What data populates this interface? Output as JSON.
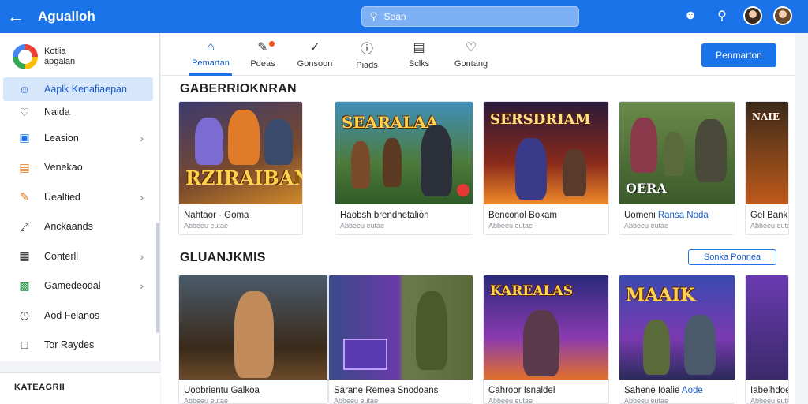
{
  "header": {
    "back_icon": "arrow-left-icon",
    "title": "Agualloh",
    "search_placeholder": "Sean",
    "icons": [
      "user-icon",
      "search-icon"
    ]
  },
  "sidebar": {
    "brand": {
      "line1": "Kotlia",
      "line2": "apgalan"
    },
    "items": [
      {
        "label": "Aaplk Kenafiaepan",
        "icon": "person-icon",
        "active": true
      },
      {
        "label": "Naida",
        "icon": "bell-icon"
      },
      {
        "label": "Leasion",
        "icon": "browser-icon",
        "chevron": true
      },
      {
        "label": "Venekao",
        "icon": "chart-icon"
      },
      {
        "label": "Uealtied",
        "icon": "pen-icon",
        "chevron": true
      },
      {
        "label": "Anckaands",
        "icon": "expand-icon"
      },
      {
        "label": "Conterll",
        "icon": "grid-icon",
        "chevron": true
      },
      {
        "label": "Gamedeodal",
        "icon": "image-icon",
        "chevron": true
      },
      {
        "label": "Aod Felanos",
        "icon": "clock-icon"
      },
      {
        "label": "Tor Raydes",
        "icon": "message-icon"
      }
    ],
    "category_title": "KATEAGRII"
  },
  "tabs": [
    {
      "label": "Pemartan",
      "icon": "home-icon",
      "active": true
    },
    {
      "label": "Pdeas",
      "icon": "edit-icon",
      "badge": true
    },
    {
      "label": "Gonsoon",
      "icon": "check-circle-icon"
    },
    {
      "label": "Piads",
      "icon": "info-icon"
    },
    {
      "label": "Sclks",
      "icon": "document-icon"
    },
    {
      "label": "Gontang",
      "icon": "bell-icon"
    }
  ],
  "primary_button": "Penmarton",
  "section1": {
    "title": "GABERRIOKNRAN",
    "cards": [
      {
        "art_title": "RZIRAIBAN",
        "title": "Nahtaor · Goma",
        "sub": "Abbeeu eutae"
      },
      {
        "art_title": "SEARALAA",
        "title": "Haobsh brendhetalion",
        "sub": "Abbeeu eutae"
      },
      {
        "art_title": "SERSDRIAM",
        "title": "Benconol Bokam",
        "sub": "Abbeeu eutae"
      },
      {
        "art_title": "OERA",
        "title": "Uomeni",
        "title_hl": "Ransa Noda",
        "sub": "Abbeeu eutae"
      },
      {
        "art_title": "NAIE",
        "title": "Gel Bank",
        "sub": "Abbeeu eutae"
      }
    ]
  },
  "section2": {
    "title": "GLUANJKMIS",
    "button": "Sonka Ponnea",
    "cards": [
      {
        "title": "Uoobrientu Galkoa",
        "sub": "Abbeeu eutae"
      },
      {
        "title": "Sarane Remea",
        "title2": "Snodoans",
        "sub": "Abbeeu eutae"
      },
      {
        "art_title": "KAREALAS",
        "title": "Cahroor Isnaldel",
        "sub": "Abbeeu eutae"
      },
      {
        "art_title": "MAAIK",
        "title": "Sahene Ioalie",
        "title_hl": "Aode",
        "sub": "Abbeeu eutae"
      },
      {
        "title": "Iabelhdoer",
        "sub": "Abbeeu eutae"
      }
    ]
  }
}
